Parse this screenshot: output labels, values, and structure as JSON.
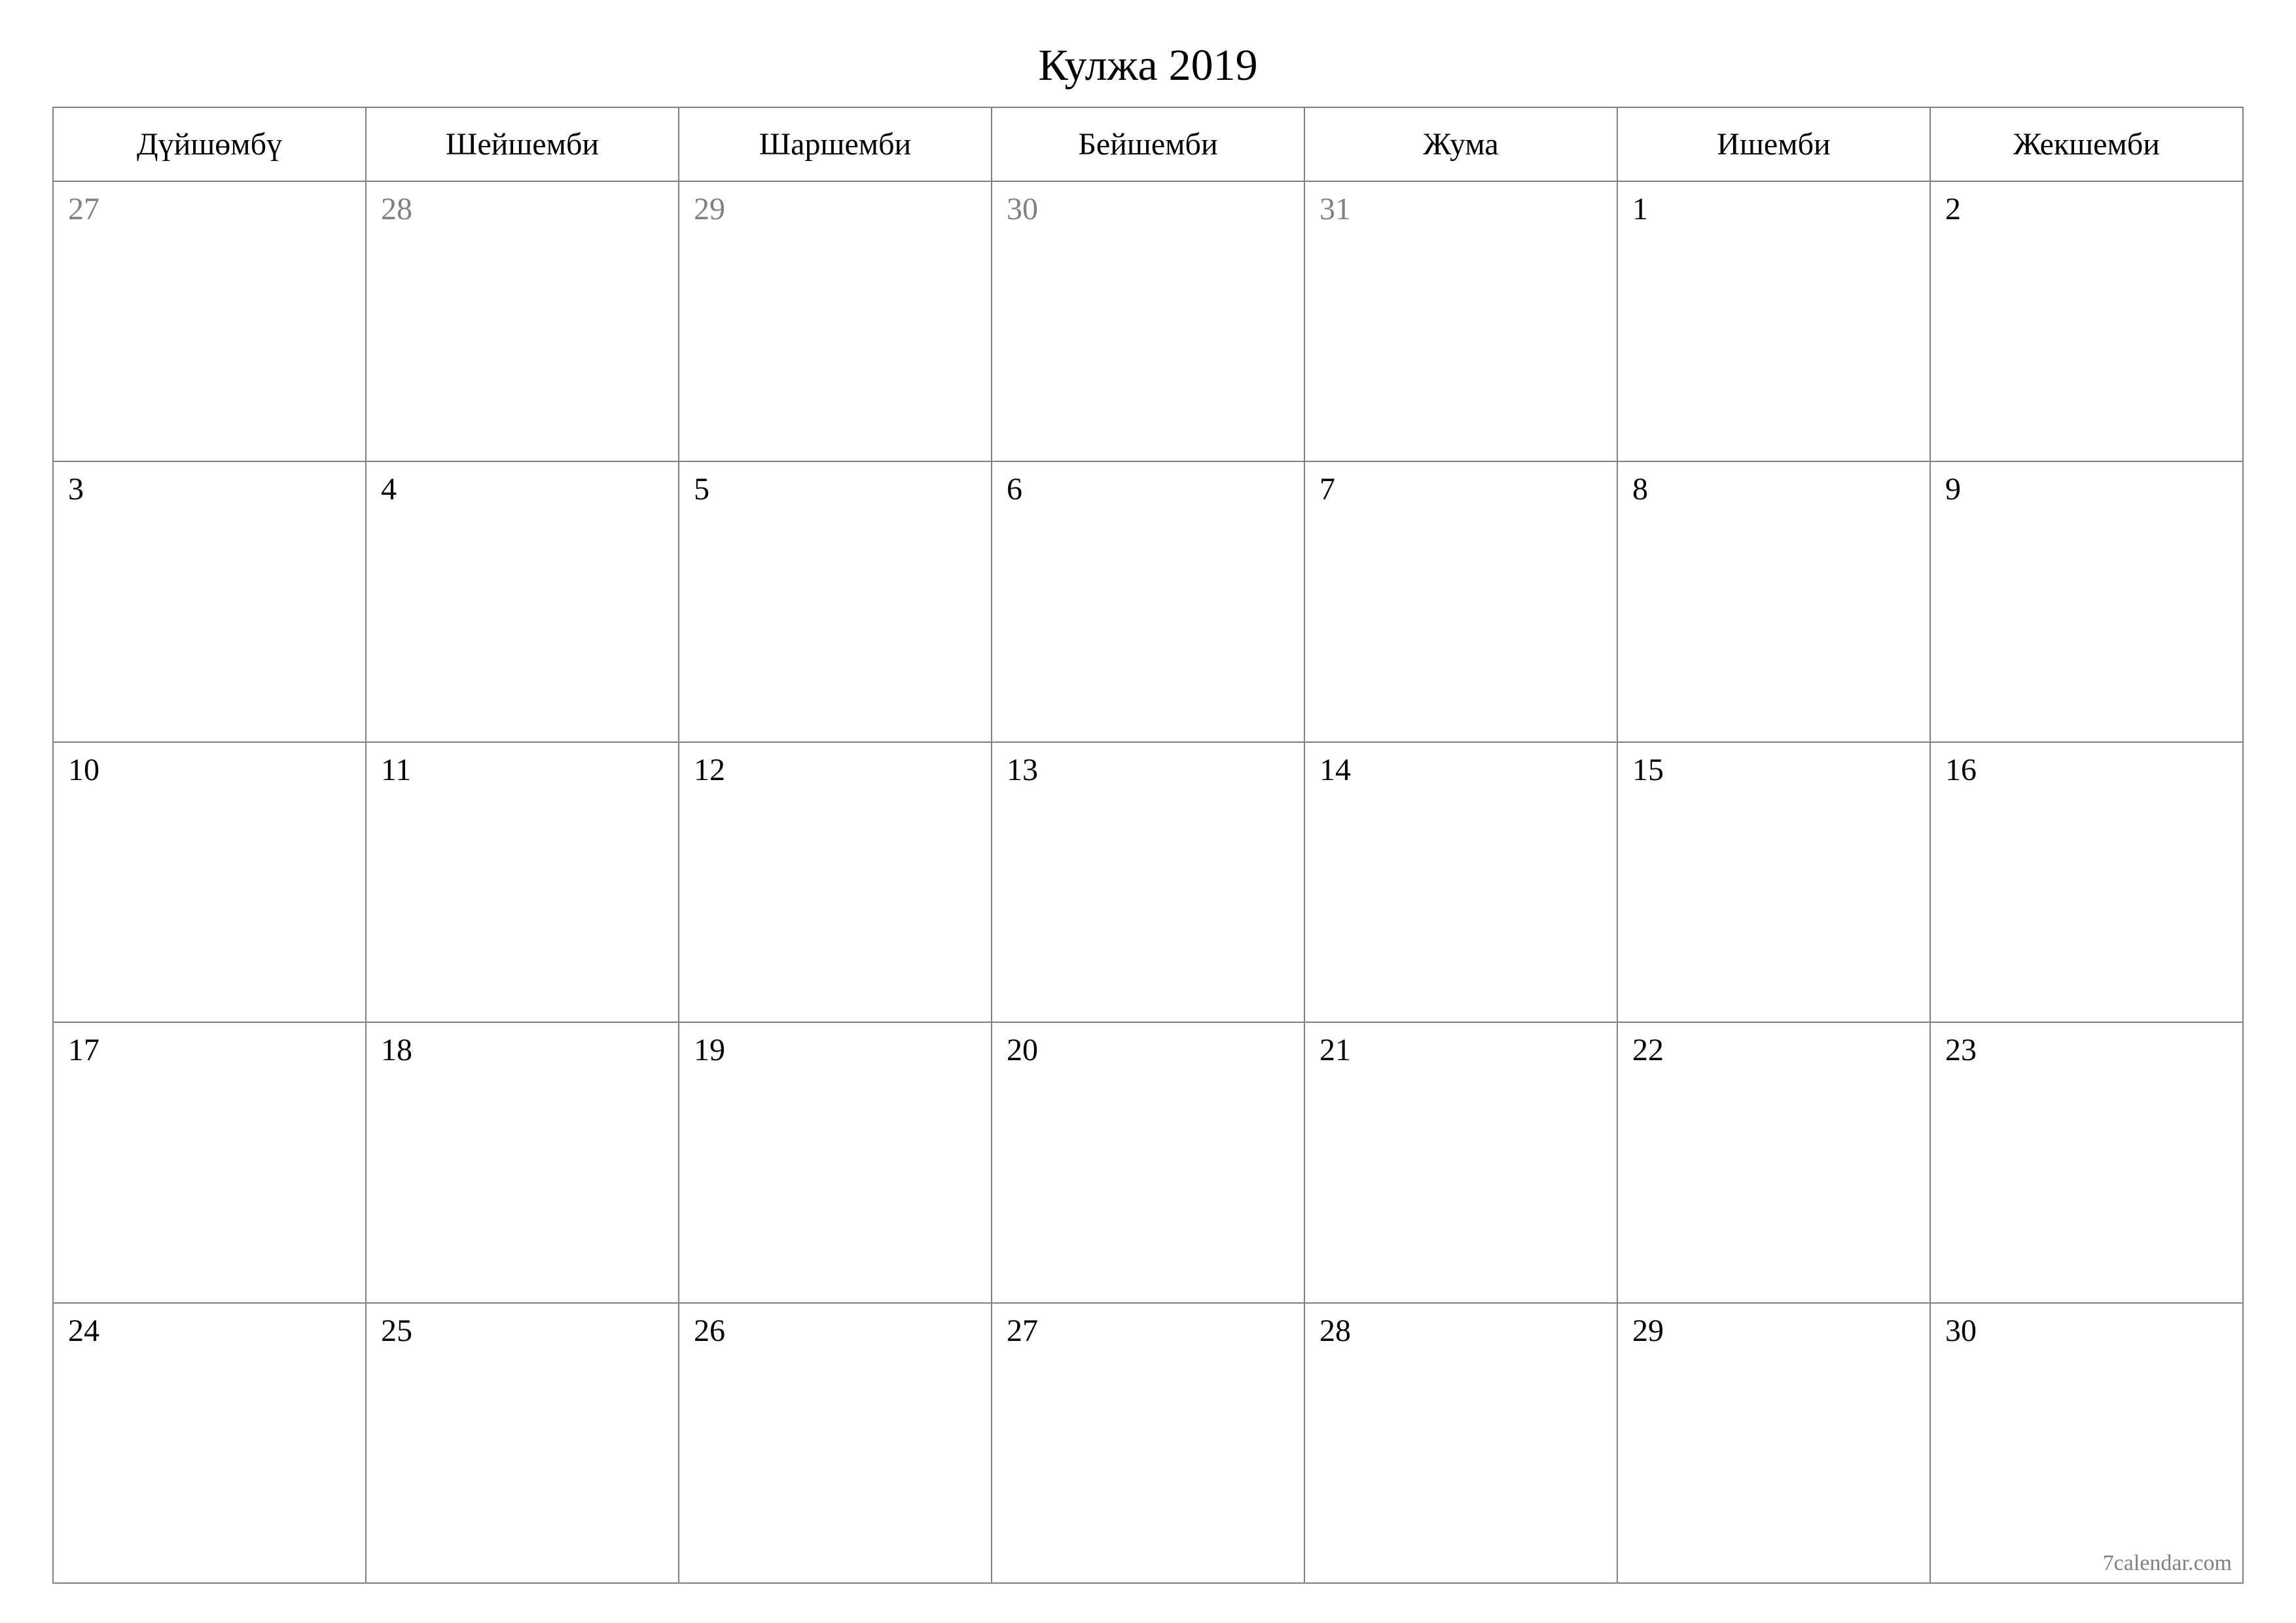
{
  "title": "Кулжа 2019",
  "weekdays": [
    "Дүйшөмбү",
    "Шейшемби",
    "Шаршемби",
    "Бейшемби",
    "Жума",
    "Ишемби",
    "Жекшемби"
  ],
  "weeks": [
    [
      {
        "n": "27",
        "other": true
      },
      {
        "n": "28",
        "other": true
      },
      {
        "n": "29",
        "other": true
      },
      {
        "n": "30",
        "other": true
      },
      {
        "n": "31",
        "other": true
      },
      {
        "n": "1",
        "other": false
      },
      {
        "n": "2",
        "other": false
      }
    ],
    [
      {
        "n": "3",
        "other": false
      },
      {
        "n": "4",
        "other": false
      },
      {
        "n": "5",
        "other": false
      },
      {
        "n": "6",
        "other": false
      },
      {
        "n": "7",
        "other": false
      },
      {
        "n": "8",
        "other": false
      },
      {
        "n": "9",
        "other": false
      }
    ],
    [
      {
        "n": "10",
        "other": false
      },
      {
        "n": "11",
        "other": false
      },
      {
        "n": "12",
        "other": false
      },
      {
        "n": "13",
        "other": false
      },
      {
        "n": "14",
        "other": false
      },
      {
        "n": "15",
        "other": false
      },
      {
        "n": "16",
        "other": false
      }
    ],
    [
      {
        "n": "17",
        "other": false
      },
      {
        "n": "18",
        "other": false
      },
      {
        "n": "19",
        "other": false
      },
      {
        "n": "20",
        "other": false
      },
      {
        "n": "21",
        "other": false
      },
      {
        "n": "22",
        "other": false
      },
      {
        "n": "23",
        "other": false
      }
    ],
    [
      {
        "n": "24",
        "other": false
      },
      {
        "n": "25",
        "other": false
      },
      {
        "n": "26",
        "other": false
      },
      {
        "n": "27",
        "other": false
      },
      {
        "n": "28",
        "other": false
      },
      {
        "n": "29",
        "other": false
      },
      {
        "n": "30",
        "other": false
      }
    ]
  ],
  "footer": "7calendar.com"
}
